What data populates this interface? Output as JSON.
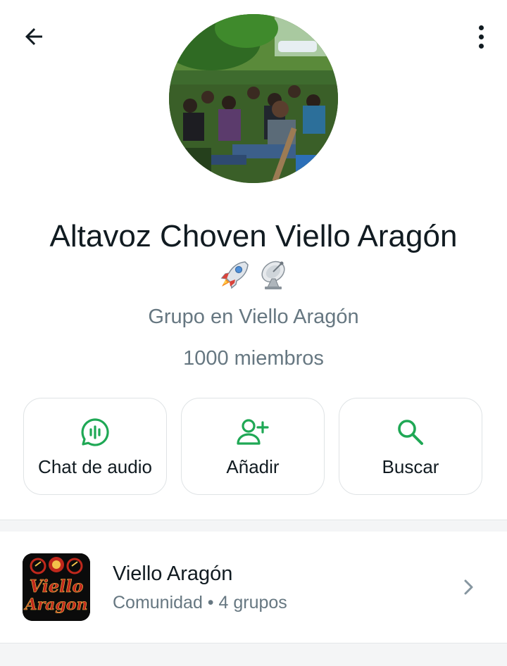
{
  "header": {
    "back_icon": "arrow-left-icon",
    "menu_icon": "more-vertical-icon"
  },
  "group": {
    "name": "Altavoz Choven Viello Aragón",
    "emoji": [
      "rocket-emoji",
      "satellite-dish-emoji"
    ],
    "subtitle": "Grupo en Viello Aragón",
    "members": "1000 miembros"
  },
  "actions": [
    {
      "label": "Chat de audio",
      "icon": "audio-chat-icon"
    },
    {
      "label": "Añadir",
      "icon": "add-person-icon"
    },
    {
      "label": "Buscar",
      "icon": "search-icon"
    }
  ],
  "community": {
    "name": "Viello Aragón",
    "subtitle": "Comunidad • 4 grupos",
    "logo_text": [
      "Viello",
      "Aragon"
    ],
    "chevron_icon": "chevron-right-icon"
  },
  "colors": {
    "accent_green": "#1fa855",
    "text_primary": "#111b21",
    "text_secondary": "#667781",
    "logo_red": "#c0281c"
  }
}
